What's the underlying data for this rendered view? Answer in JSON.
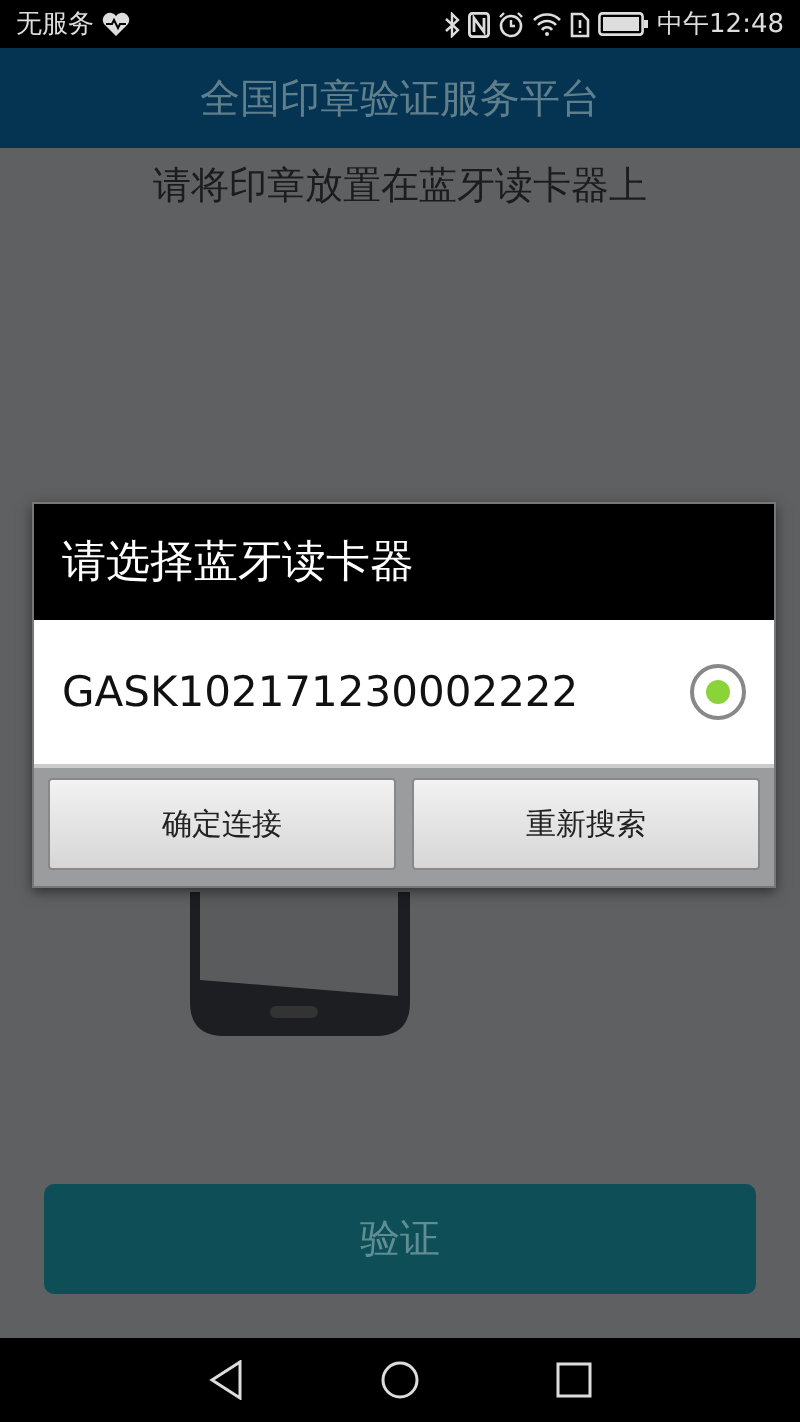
{
  "status_bar": {
    "carrier": "无服务",
    "time": "中午12:48"
  },
  "header": {
    "title": "全国印章验证服务平台"
  },
  "instruction": "请将印章放置在蓝牙读卡器上",
  "verify_button": "验证",
  "dialog": {
    "title": "请选择蓝牙读卡器",
    "devices": [
      {
        "name": "GASK102171230002222",
        "selected": true
      }
    ],
    "buttons": [
      "确定连接",
      "重新搜索"
    ]
  }
}
